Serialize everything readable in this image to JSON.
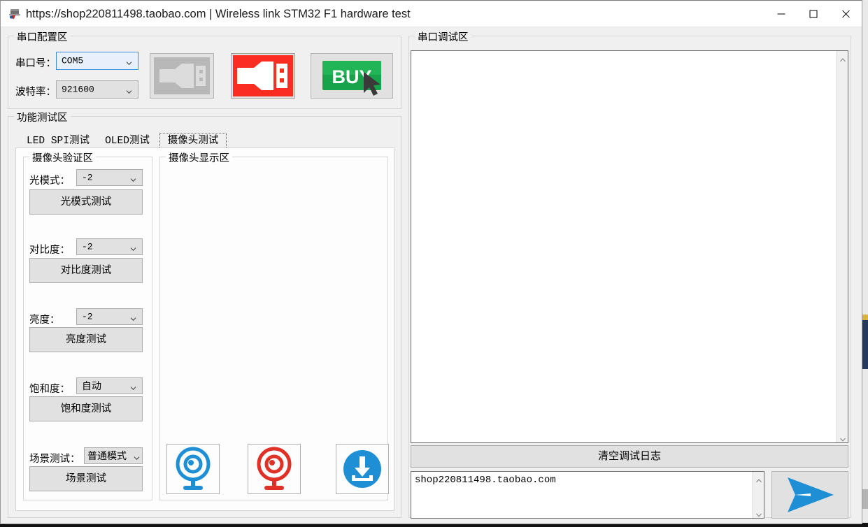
{
  "window": {
    "title": "https://shop220811498.taobao.com | Wireless link STM32 F1 hardware test",
    "app_icon": "serial-device-icon",
    "controls": {
      "minimize": "minimize-icon",
      "maximize": "maximize-icon",
      "close": "close-icon"
    }
  },
  "serial_config": {
    "title": "串口配置区",
    "port_label": "串口号：",
    "port_value": "COM5",
    "baud_label": "波特率：",
    "baud_value": "921600",
    "buttons": [
      {
        "name": "usb-disconnected-icon",
        "alt": "串口未连接"
      },
      {
        "name": "usb-connect-icon",
        "alt": "连接串口"
      },
      {
        "name": "buy-icon",
        "alt": "BUY",
        "text": "BUY"
      }
    ]
  },
  "function_test": {
    "title": "功能测试区",
    "tabs": [
      {
        "label": "LED SPI测试",
        "selected": false
      },
      {
        "label": "OLED测试",
        "selected": false
      },
      {
        "label": "摄像头测试",
        "selected": true
      }
    ]
  },
  "camera_verify": {
    "title": "摄像头验证区",
    "rows": [
      {
        "label": "光模式：",
        "value": "-2",
        "button": "光模式测试"
      },
      {
        "label": "对比度：",
        "value": "-2",
        "button": "对比度测试"
      },
      {
        "label": "亮度：",
        "value": "-2",
        "button": "亮度测试"
      },
      {
        "label": "饱和度：",
        "value": "自动",
        "button": "饱和度测试"
      },
      {
        "label": "场景测试：",
        "value": "普通模式",
        "button": "场景测试"
      }
    ]
  },
  "camera_display": {
    "title": "摄像头显示区",
    "actions": [
      {
        "name": "camera-start-icon",
        "color": "#1e8fd5"
      },
      {
        "name": "camera-stop-icon",
        "color": "#e03127"
      },
      {
        "name": "download-icon",
        "color": "#1e8fd5"
      }
    ]
  },
  "serial_debug": {
    "title": "串口调试区",
    "log_text": "",
    "clear_button": "清空调试日志",
    "send_value": "shop220811498.taobao.com",
    "send_button_icon": "send-arrow-icon",
    "scroll_up_icon": "chevron-up-icon",
    "scroll_down_icon": "chevron-down-icon"
  },
  "colors": {
    "accent_blue": "#1e8fd5",
    "red": "#e03127",
    "green": "#18a84c",
    "focus_blue": "#3c8cdc",
    "face": "#f0f0f0"
  }
}
